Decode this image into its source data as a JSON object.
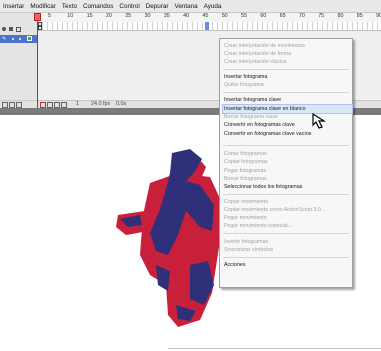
{
  "menubar": {
    "items": [
      "Insertar",
      "Modificar",
      "Texto",
      "Comandos",
      "Control",
      "Depurar",
      "Ventana",
      "Ayuda"
    ]
  },
  "timeline": {
    "ruler_ticks": [
      "5",
      "10",
      "15",
      "20",
      "25",
      "30",
      "35",
      "40",
      "45",
      "50",
      "55",
      "60",
      "65",
      "70",
      "75",
      "80",
      "85",
      "90"
    ],
    "footer": {
      "frame": "1",
      "fps": "24.0 fps",
      "time": "0,0s"
    }
  },
  "context_menu": {
    "items": [
      {
        "label": "Crear interpolación de movimiento",
        "enabled": false
      },
      {
        "label": "Crear interpolación de forma",
        "enabled": false
      },
      {
        "label": "Crear interpolación clásica",
        "enabled": false
      },
      {
        "label": "Insertar fotograma",
        "enabled": true
      },
      {
        "label": "Quitar fotograma",
        "enabled": false
      },
      {
        "label": "Insertar fotograma clave",
        "enabled": true
      },
      {
        "label": "Insertar fotograma clave en blanco",
        "enabled": true,
        "highlighted": true
      },
      {
        "label": "Borrar fotograma clave",
        "enabled": false
      },
      {
        "label": "Convertir en fotogramas clave",
        "enabled": true
      },
      {
        "label": "Convertir en fotogramas clave vacíos",
        "enabled": true
      },
      {
        "label": "Cortar fotogramas",
        "enabled": false
      },
      {
        "label": "Copiar fotogramas",
        "enabled": false
      },
      {
        "label": "Pegar fotogramas",
        "enabled": false
      },
      {
        "label": "Borrar fotogramas",
        "enabled": false
      },
      {
        "label": "Seleccionar todos los fotogramas",
        "enabled": true
      },
      {
        "label": "Copiar movimiento",
        "enabled": false
      },
      {
        "label": "Copiar movimiento como ActionScript 3.0...",
        "enabled": false
      },
      {
        "label": "Pegar movimiento",
        "enabled": false
      },
      {
        "label": "Pegar movimiento especial...",
        "enabled": false
      },
      {
        "label": "Invertir fotogramas",
        "enabled": false
      },
      {
        "label": "Sincronizar símbolos",
        "enabled": false
      },
      {
        "label": "Acciones",
        "enabled": true
      }
    ]
  },
  "colors": {
    "accent_blue": "#2f2f7a",
    "accent_red": "#c8203a",
    "highlight": "#d9e7fa"
  }
}
